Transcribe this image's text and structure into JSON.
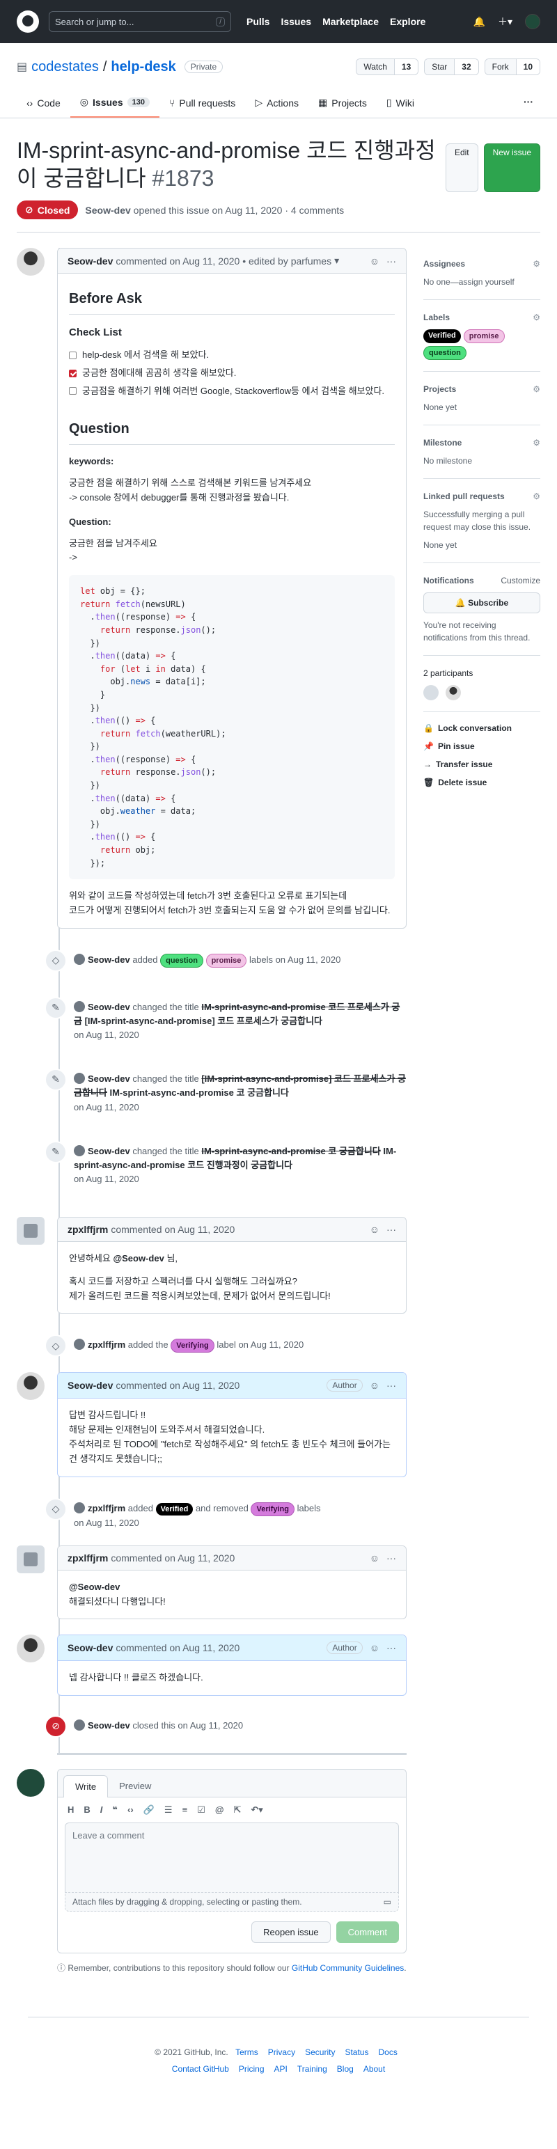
{
  "header": {
    "search_placeholder": "Search or jump to...",
    "slash": "/",
    "nav": [
      "Pulls",
      "Issues",
      "Marketplace",
      "Explore"
    ]
  },
  "repo": {
    "owner": "codestates",
    "name": "help-desk",
    "visibility": "Private",
    "watch": "Watch",
    "watch_count": "13",
    "star": "Star",
    "star_count": "32",
    "fork": "Fork",
    "fork_count": "10"
  },
  "tabs": [
    {
      "label": "Code"
    },
    {
      "label": "Issues",
      "count": "130"
    },
    {
      "label": "Pull requests"
    },
    {
      "label": "Actions"
    },
    {
      "label": "Projects"
    },
    {
      "label": "Wiki"
    }
  ],
  "issue": {
    "title": "IM-sprint-async-and-promise 코드 진행과정이 궁금합니다",
    "number": "#1873",
    "edit": "Edit",
    "new_issue": "New issue",
    "status": "Closed",
    "author": "Seow-dev",
    "meta": "opened this issue on Aug 11, 2020 · 4 comments"
  },
  "first_comment": {
    "author": "Seow-dev",
    "meta": "commented on Aug 11, 2020 • edited by parfumes",
    "h2a": "Before Ask",
    "h3": "Check List",
    "checks": [
      {
        "text": "help-desk 에서 검색을 해 보았다.",
        "checked": false
      },
      {
        "text": "궁금한 점에대해 곰곰히 생각을 해보았다.",
        "checked": true
      },
      {
        "text": "궁금점을 해결하기 위해 여러번 Google, Stackoverflow등 에서 검색을 해보았다.",
        "checked": false
      }
    ],
    "h2b": "Question",
    "kw_label": "keywords:",
    "kw1": "궁금한 점을 해결하기 위해 스스로 검색해본 키워드를 남겨주세요",
    "kw2": "-> console 창에서 debugger를 통해 진행과정을 봤습니다.",
    "q_label": "Question:",
    "q1": "궁금한 점을 남겨주세요",
    "q2": "->",
    "after1": "위와 같이 코드를 작성하였는데 fetch가 3번 호출된다고 오류로 표기되는데",
    "after2": "코드가 어떻게 진행되어서 fetch가 3번 호출되는지 도움 알 수가 없어 문의를 남깁니다."
  },
  "events": {
    "e1": {
      "user": "Seow-dev",
      "added": "added",
      "l1": "question",
      "l2": "promise",
      "tail": "labels on Aug 11, 2020"
    },
    "e2": {
      "user": "Seow-dev",
      "verb": "changed the title",
      "old": "IM-sprint-async-and-promise 코드 프로세스가 궁금",
      "new": "[IM-sprint-async-and-promise] 코드 프로세스가 궁금합니다",
      "date": "on Aug 11, 2020"
    },
    "e3": {
      "user": "Seow-dev",
      "verb": "changed the title",
      "old": "[IM-sprint-async-and-promise] 코드 프로세스가 궁금합니다",
      "new": "IM-sprint-async-and-promise 코 궁금합니다",
      "date": "on Aug 11, 2020"
    },
    "e4": {
      "user": "Seow-dev",
      "verb": "changed the title",
      "old": "IM-sprint-async-and-promise 코 궁금합니다",
      "new": "IM-sprint-async-and-promise 코드 진행과정이 궁금합니다",
      "date": "on Aug 11, 2020"
    },
    "e5": {
      "user": "zpxlffjrm",
      "added": "added the",
      "label": "Verifying",
      "tail": "label on Aug 11, 2020"
    },
    "e6": {
      "user": "zpxlffjrm",
      "added": "added",
      "l1": "Verified",
      "mid": "and removed",
      "l2": "Verifying",
      "tail": "labels",
      "date": "on Aug 11, 2020"
    },
    "e7": {
      "user": "Seow-dev",
      "text": "closed this on Aug 11, 2020"
    }
  },
  "c2": {
    "author": "zpxlffjrm",
    "meta": "commented on Aug 11, 2020",
    "l1a": "안녕하세요",
    "l1b": "@Seow-dev",
    "l1c": "님,",
    "l2": "혹시 코드를 저장하고 스펙러너를 다시 실행해도 그러실까요?",
    "l3": "제가 올려드린 코드를 적용시켜보았는데, 문제가 없어서 문의드립니다!"
  },
  "c3": {
    "author": "Seow-dev",
    "meta": "commented on Aug 11, 2020",
    "role": "Author",
    "l1": "답변 감사드립니다 !!",
    "l2": "해당 문제는 인재현님이 도와주셔서 해결되었습니다.",
    "l3": "주석처리로 된 TODO에 \"fetch로 작성해주세요\" 의 fetch도 총 빈도수 체크에 들어가는건 생각지도 못했습니다;;"
  },
  "c4": {
    "author": "zpxlffjrm",
    "meta": "commented on Aug 11, 2020",
    "l1": "@Seow-dev",
    "l2": "해결되셨다니 다행입니다!"
  },
  "c5": {
    "author": "Seow-dev",
    "meta": "commented on Aug 11, 2020",
    "role": "Author",
    "l1": "넵 감사합니다 !! 클로즈 하겠습니다."
  },
  "new_comment": {
    "write": "Write",
    "preview": "Preview",
    "placeholder": "Leave a comment",
    "attach": "Attach files by dragging & dropping, selecting or pasting them.",
    "reopen": "Reopen issue",
    "comment": "Comment",
    "notice1": "Remember, contributions to this repository should follow our",
    "notice_link": "GitHub Community Guidelines",
    "notice_end": "."
  },
  "sidebar": {
    "assignees": {
      "title": "Assignees",
      "value": "No one—assign yourself"
    },
    "labels": {
      "title": "Labels",
      "items": [
        "Verified",
        "promise",
        "question"
      ]
    },
    "projects": {
      "title": "Projects",
      "value": "None yet"
    },
    "milestone": {
      "title": "Milestone",
      "value": "No milestone"
    },
    "linked": {
      "title": "Linked pull requests",
      "desc": "Successfully merging a pull request may close this issue.",
      "value": "None yet"
    },
    "notifications": {
      "title": "Notifications",
      "customize": "Customize",
      "subscribe": "Subscribe",
      "desc": "You're not receiving notifications from this thread."
    },
    "participants": "2 participants",
    "actions": [
      "Lock conversation",
      "Pin issue",
      "Transfer issue",
      "Delete issue"
    ]
  },
  "footer": {
    "copy": "© 2021 GitHub, Inc.",
    "row1": [
      "Terms",
      "Privacy",
      "Security",
      "Status",
      "Docs"
    ],
    "row2": [
      "Contact GitHub",
      "Pricing",
      "API",
      "Training",
      "Blog",
      "About"
    ]
  }
}
